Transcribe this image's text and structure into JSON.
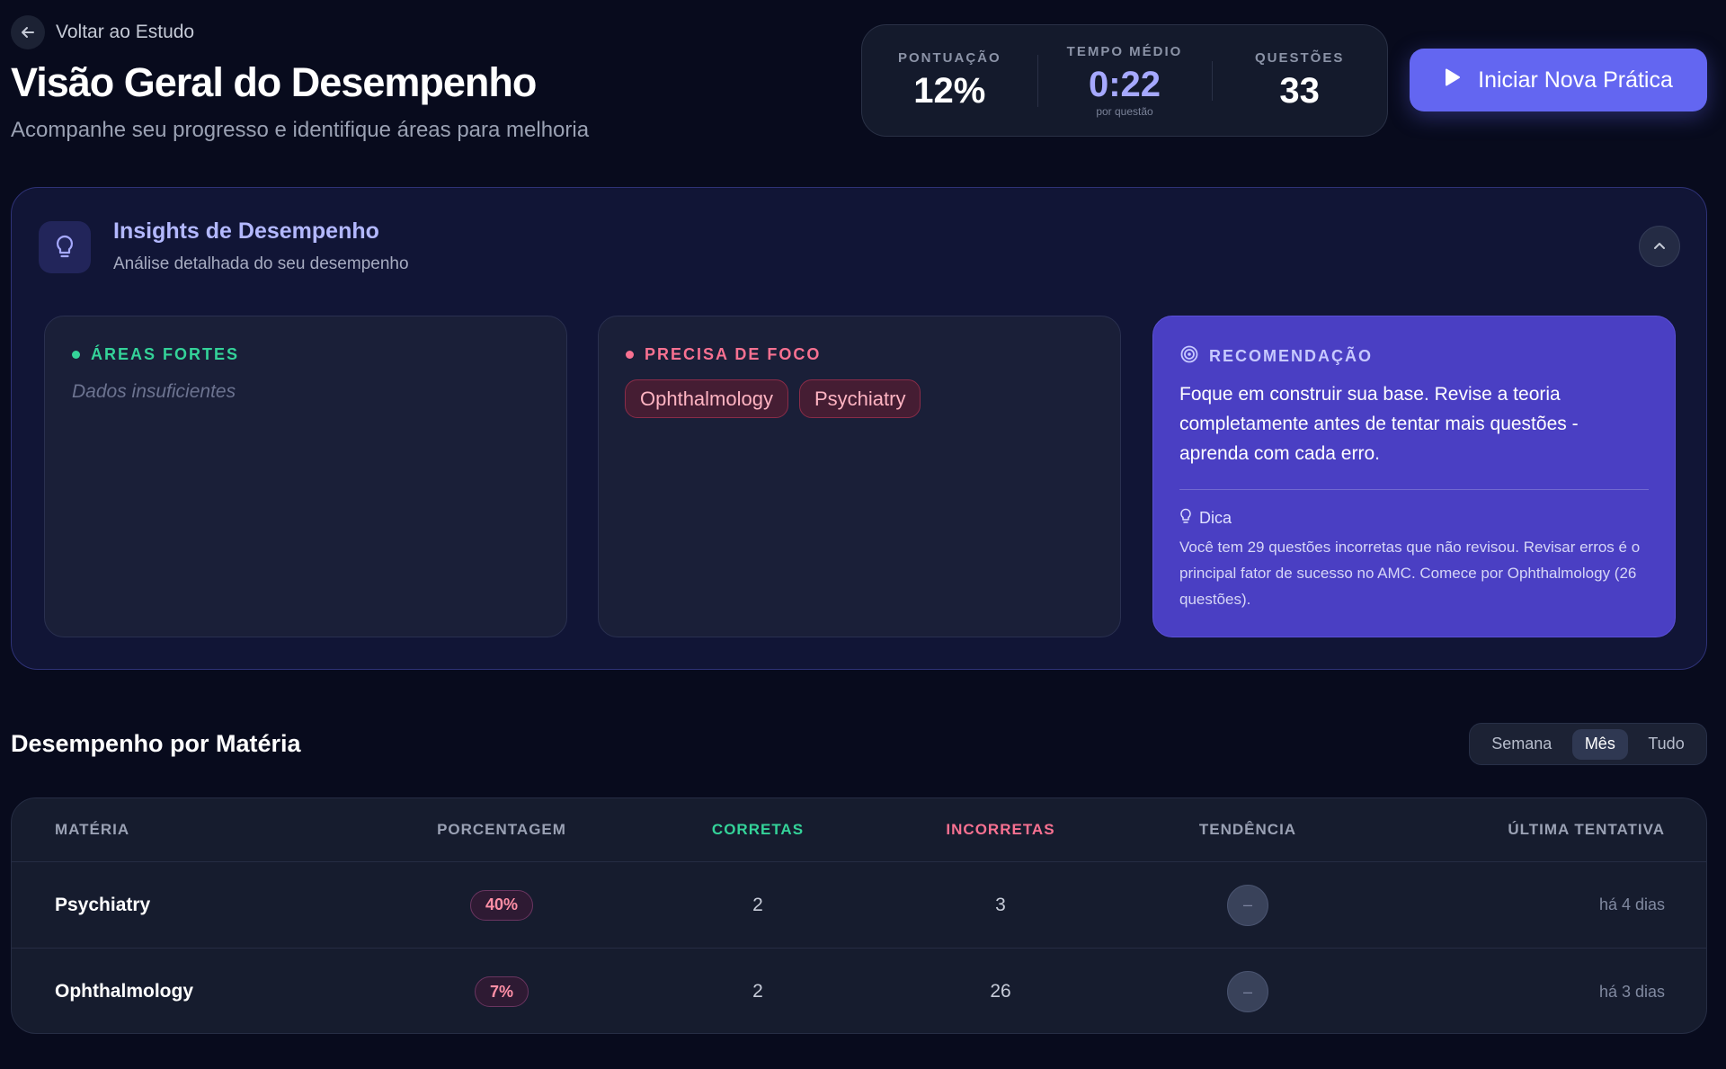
{
  "header": {
    "back_label": "Voltar ao Estudo",
    "title": "Visão Geral do Desempenho",
    "subtitle": "Acompanhe seu progresso e identifique áreas para melhoria"
  },
  "stats": {
    "score_label": "PONTUAÇÃO",
    "score_value": "12%",
    "avg_time_label": "TEMPO MÉDIO",
    "avg_time_value": "0:22",
    "avg_time_sub": "por questão",
    "questions_label": "QUESTÕES",
    "questions_value": "33"
  },
  "primary_button": {
    "label": "Iniciar Nova Prática"
  },
  "insights": {
    "title": "Insights de Desempenho",
    "subtitle": "Análise detalhada do seu desempenho",
    "strong": {
      "label": "ÁREAS FORTES",
      "empty_text": "Dados insuficientes",
      "color": "#34d399"
    },
    "focus": {
      "label": "PRECISA DE FOCO",
      "color": "#f87191",
      "chips": [
        "Ophthalmology",
        "Psychiatry"
      ]
    },
    "recommendation": {
      "label": "RECOMENDAÇÃO",
      "text": "Foque em construir sua base. Revise a teoria completamente antes de tentar mais questões - aprenda com cada erro.",
      "tip_label": "Dica",
      "tip_text": "Você tem 29 questões incorretas que não revisou. Revisar erros é o principal fator de sucesso no AMC. Comece por Ophthalmology (26 questões)."
    }
  },
  "subjects": {
    "title": "Desempenho por Matéria",
    "periods": [
      "Semana",
      "Mês",
      "Tudo"
    ],
    "active_period": "Mês",
    "columns": [
      "MATÉRIA",
      "PORCENTAGEM",
      "CORRETAS",
      "INCORRETAS",
      "TENDÊNCIA",
      "ÚLTIMA TENTATIVA"
    ],
    "rows": [
      {
        "subject": "Psychiatry",
        "percentage": "40%",
        "correct": "2",
        "incorrect": "3",
        "trend": "–",
        "last_attempt": "há 4 dias"
      },
      {
        "subject": "Ophthalmology",
        "percentage": "7%",
        "correct": "2",
        "incorrect": "26",
        "trend": "–",
        "last_attempt": "há 3 dias"
      }
    ]
  },
  "colors": {
    "accent": "#6366f1",
    "correct": "#34d399",
    "incorrect": "#f87191"
  }
}
